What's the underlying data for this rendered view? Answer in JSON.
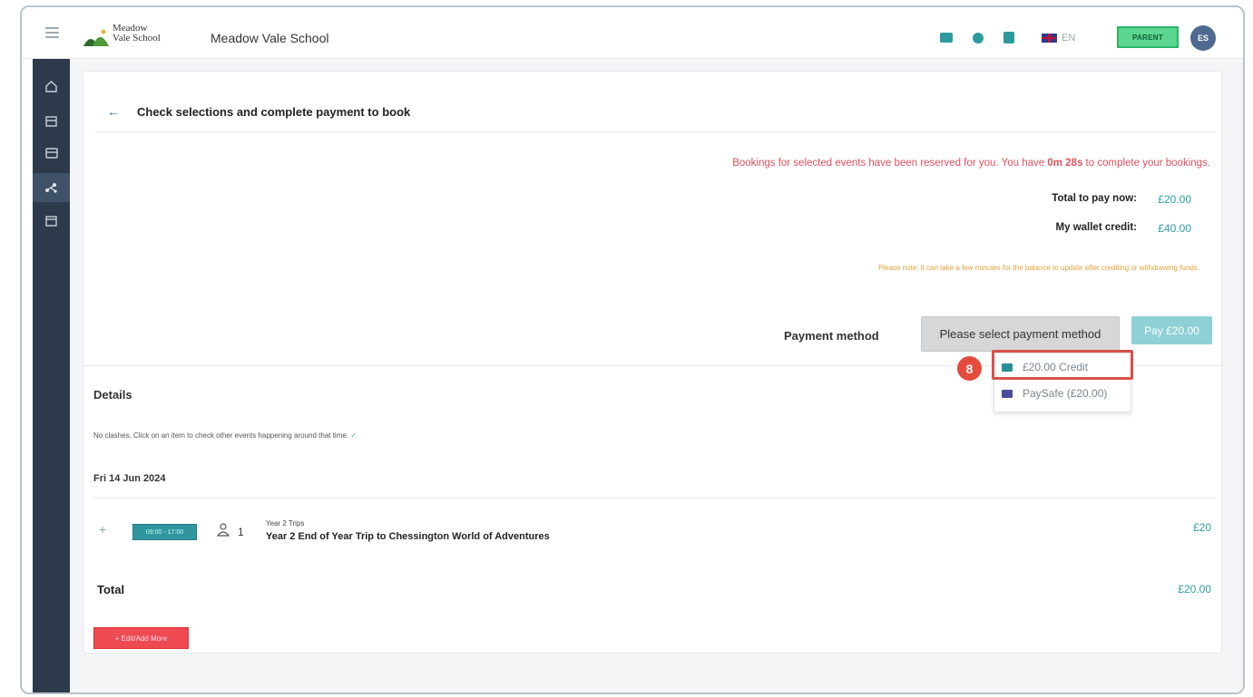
{
  "header": {
    "logo_text_line1": "Meadow",
    "logo_text_line2": "Vale School",
    "school_name": "Meadow Vale School",
    "icons": [
      "mail-icon",
      "support-icon",
      "wallet-icon"
    ],
    "language": "EN",
    "role_badge": "PARENT",
    "avatar_initials": "ES",
    "colors": {
      "accent": "#2e9a9e",
      "role_badge": "#5cd68e",
      "avatar": "#4f6a8f"
    }
  },
  "sidebar": {
    "items": [
      {
        "icon": "home-icon"
      },
      {
        "icon": "calendar-icon"
      },
      {
        "icon": "payments-icon"
      },
      {
        "icon": "activities-icon",
        "active": true
      },
      {
        "icon": "window-icon"
      }
    ]
  },
  "page": {
    "title": "Check selections and complete payment to book",
    "notice_prefix": "Bookings for selected events have been reserved for you. You have ",
    "notice_time": "0m 28s",
    "notice_suffix": " to complete your bookings.",
    "total_label": "Total to pay now:",
    "total_value": "£20.00",
    "wallet_label": "My wallet credit:",
    "wallet_value": "£40.00",
    "note": "Please note: it can take a few minutes for the balance to update after crediting or withdrawing funds.",
    "payment_method_label": "Payment method",
    "payment_select_placeholder": "Please select payment method",
    "pay_button": "Pay £20.00",
    "dropdown_options": [
      {
        "label": "£20.00 Credit",
        "icon": "credit-card-icon",
        "highlighted": true
      },
      {
        "label": "PaySafe (£20.00)",
        "icon": "paysafe-card-icon"
      }
    ],
    "step_number": "8"
  },
  "details": {
    "title": "Details",
    "clash_text": "No clashes. Click on an item to check other events happening around that time.",
    "clash_tick": "✓",
    "date": "Fri 14 Jun 2024",
    "event": {
      "time": "09:00 - 17:00",
      "count": "1",
      "category": "Year 2 Trips",
      "name": "Year 2 End of Year Trip to Chessington World of Adventures",
      "price": "£20"
    },
    "total_label": "Total",
    "total_value": "£20.00",
    "edit_button": "+ Edit/Add More"
  }
}
